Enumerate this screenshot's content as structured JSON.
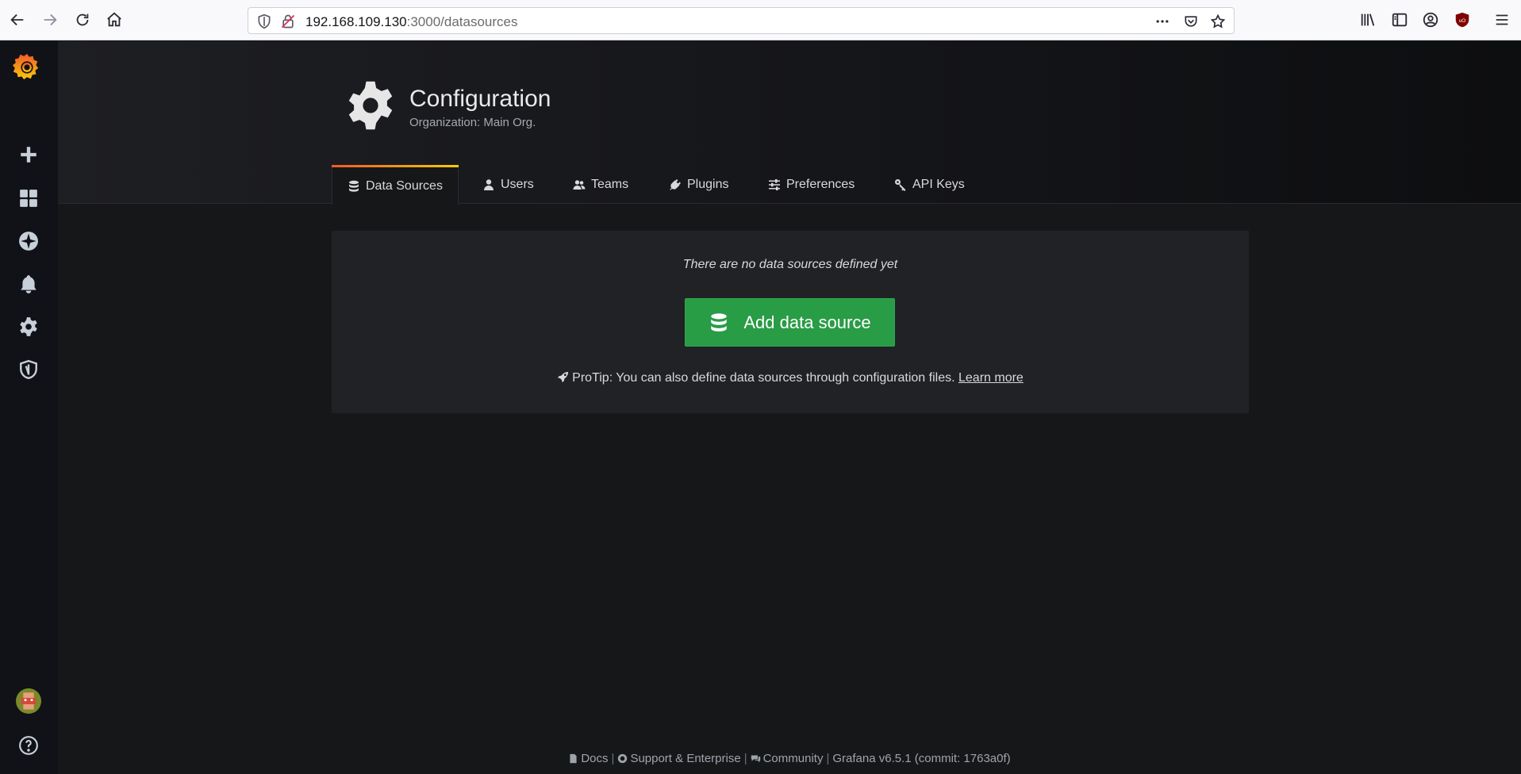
{
  "browser": {
    "url_host": "192.168.109.130",
    "url_path": ":3000/datasources",
    "icons": [
      "back-icon",
      "forward-icon",
      "reload-icon",
      "home-icon",
      "shield-icon",
      "insecure-lock-icon",
      "more-icon",
      "pocket-icon",
      "bookmark-star-icon",
      "library-icon",
      "sidebar-icon",
      "account-icon",
      "ublock-icon",
      "menu-icon"
    ]
  },
  "sidemenu": {
    "items": [
      "grafana-logo",
      "create",
      "dashboards",
      "explore",
      "alerting",
      "configuration",
      "server-admin"
    ],
    "bottom": [
      "avatar",
      "help"
    ]
  },
  "header": {
    "title": "Configuration",
    "subtitle": "Organization: Main Org."
  },
  "tabs": [
    {
      "label": "Data Sources",
      "icon": "database-icon",
      "active": true
    },
    {
      "label": "Users",
      "icon": "user-icon",
      "active": false
    },
    {
      "label": "Teams",
      "icon": "users-icon",
      "active": false
    },
    {
      "label": "Plugins",
      "icon": "plug-icon",
      "active": false
    },
    {
      "label": "Preferences",
      "icon": "sliders-icon",
      "active": false
    },
    {
      "label": "API Keys",
      "icon": "key-icon",
      "active": false
    }
  ],
  "empty_state": {
    "message": "There are no data sources defined yet",
    "button_label": "Add data source",
    "protip": "ProTip: You can also define data sources through configuration files.",
    "learn_more": "Learn more"
  },
  "footer": {
    "docs": "Docs",
    "support": "Support & Enterprise",
    "community": "Community",
    "version": "Grafana v6.5.1 (commit: 1763a0f)"
  },
  "colors": {
    "primary_button": "#299c46",
    "tab_accent_start": "#f05a28",
    "tab_accent_end": "#fbca0a",
    "background": "#161719"
  }
}
